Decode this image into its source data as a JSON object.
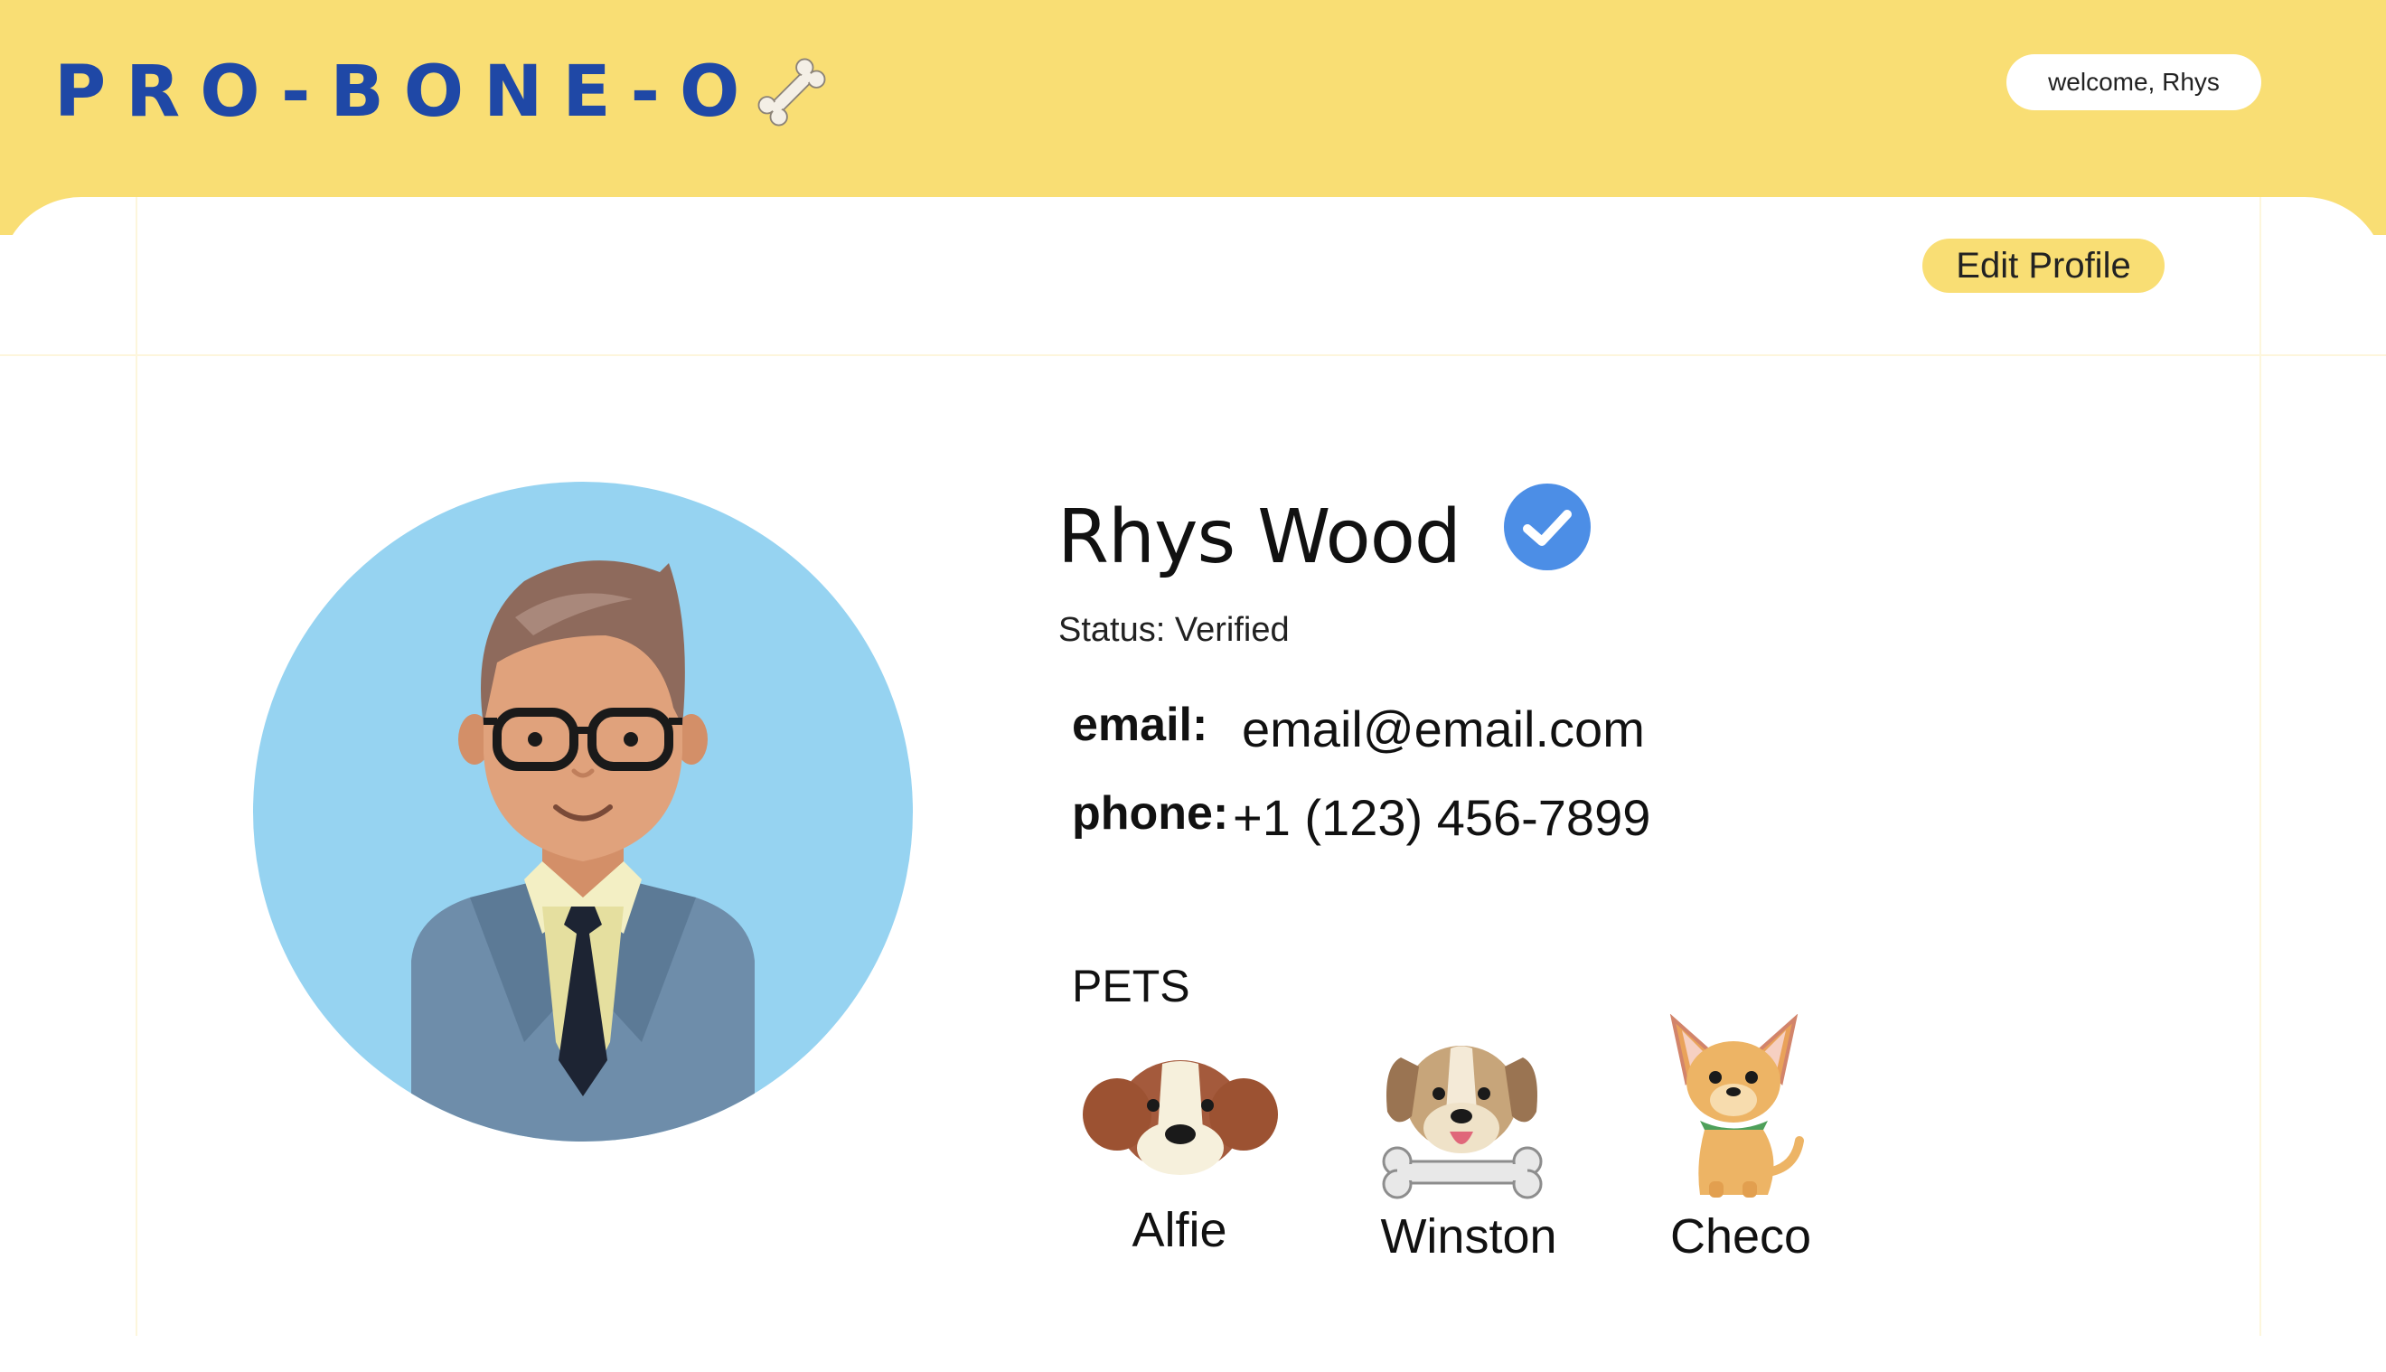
{
  "header": {
    "logo_text": "PRO-BONE-O",
    "logo_icon": "bone-icon",
    "welcome": "welcome, Rhys",
    "background_color": "#f9de74",
    "logo_color": "#1f48a6"
  },
  "toolbar": {
    "edit_label": "Edit Profile"
  },
  "profile": {
    "name": "Rhys Wood",
    "verified_icon": "verified-check-icon",
    "status": "Status: Verified",
    "email_label": "email:",
    "email": "email@email.com",
    "phone_label": "phone:",
    "phone": "+1 (123) 456-7899"
  },
  "pets": {
    "title": "PETS",
    "items": [
      {
        "name": "Alfie",
        "icon": "beagle-icon"
      },
      {
        "name": "Winston",
        "icon": "puppy-bone-icon"
      },
      {
        "name": "Checo",
        "icon": "chihuahua-icon"
      }
    ]
  }
}
